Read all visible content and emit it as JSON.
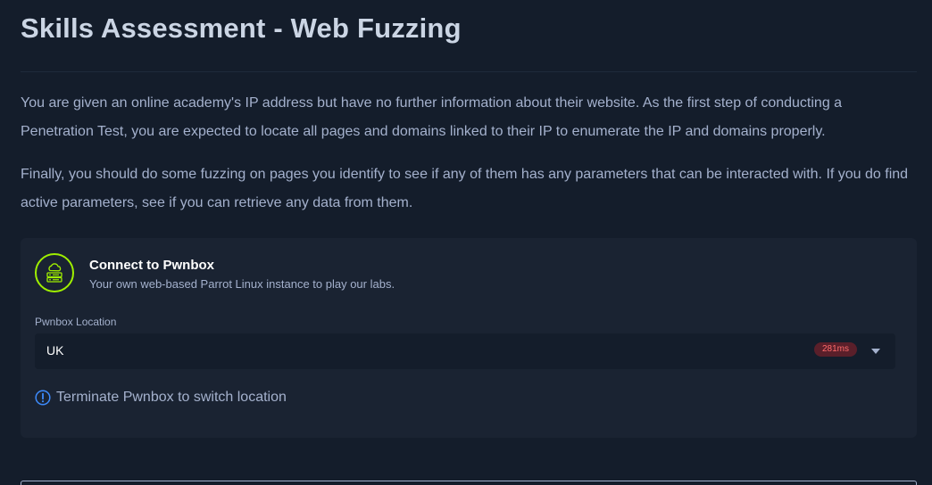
{
  "page": {
    "title": "Skills Assessment - Web Fuzzing",
    "paragraphs": [
      "You are given an online academy's IP address but have no further information about their website. As the first step of conducting a Penetration Test, you are expected to locate all pages and domains linked to their IP to enumerate the IP and domains properly.",
      "Finally, you should do some fuzzing on pages you identify to see if any of them has any parameters that can be interacted with. If you do find active parameters, see if you can retrieve any data from them."
    ]
  },
  "pwnbox": {
    "icon": "cloud-server-icon",
    "title": "Connect to Pwnbox",
    "subtitle": "Your own web-based Parrot Linux instance to play our labs.",
    "location_label": "Pwnbox Location",
    "location_value": "UK",
    "latency": "281ms",
    "notice_icon": "info-circle-icon",
    "notice": "Terminate Pwnbox to switch location"
  },
  "colors": {
    "background": "#141d2b",
    "card": "#1a2332",
    "accent": "#9fef00",
    "text": "#a4b1cd",
    "latency_bg": "#5a1f2a",
    "latency_text": "#ff6b6b",
    "info": "#3d8bfd"
  }
}
